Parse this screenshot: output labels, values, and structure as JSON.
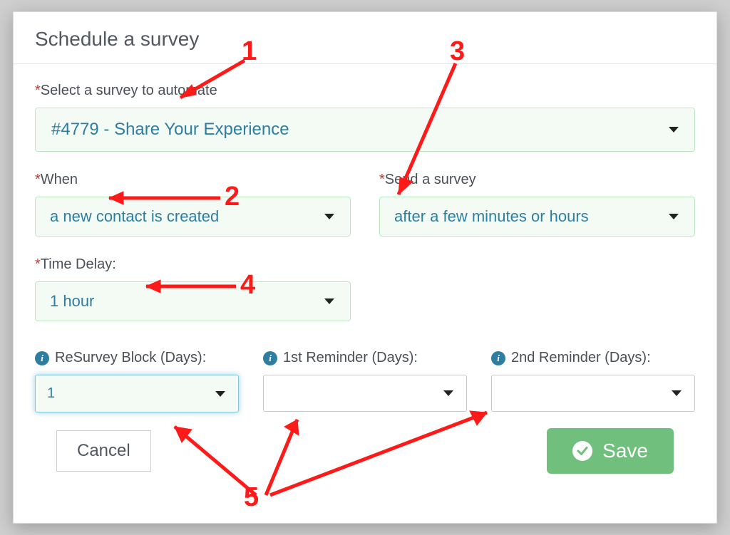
{
  "modal": {
    "title": "Schedule a survey",
    "select_survey": {
      "label_prefix": "*",
      "label": "Select a survey to automate",
      "value": "#4779 - Share Your Experience"
    },
    "when": {
      "label_prefix": "*",
      "label": "When",
      "value": "a new contact is created"
    },
    "send": {
      "label_prefix": "*",
      "label": "Send a survey",
      "value": "after a few minutes or hours"
    },
    "time_delay": {
      "label_prefix": "*",
      "label": "Time Delay:",
      "value": "1 hour"
    },
    "resurvey": {
      "label": "ReSurvey Block (Days):",
      "value": "1"
    },
    "reminder1": {
      "label": "1st Reminder (Days):",
      "value": ""
    },
    "reminder2": {
      "label": "2nd Reminder (Days):",
      "value": ""
    },
    "cancel_label": "Cancel",
    "save_label": "Save"
  },
  "annotations": {
    "n1": "1",
    "n2": "2",
    "n3": "3",
    "n4": "4",
    "n5": "5"
  }
}
